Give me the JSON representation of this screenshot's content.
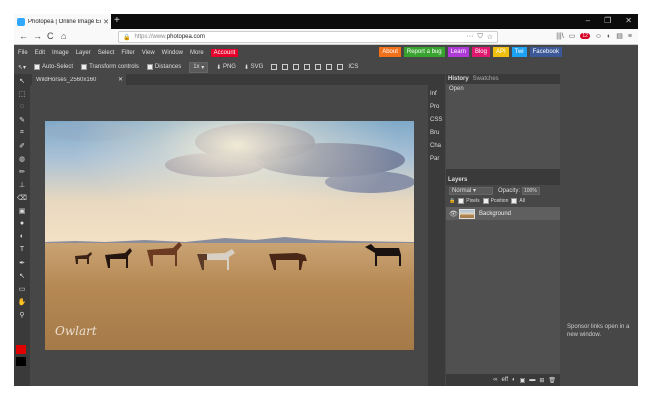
{
  "browser": {
    "tab_title": "Photopea | Online Image Editor",
    "tab_close": "✕",
    "new_tab": "+",
    "window_controls": [
      "–",
      "❐",
      "✕"
    ],
    "nav": {
      "back": "←",
      "forward": "→",
      "reload": "C",
      "home": "⌂"
    },
    "url_scheme": "https://www.",
    "url_host": "photopea.com",
    "url_actions": [
      "···",
      "⛉",
      "☆"
    ],
    "right_icons": [
      "|||\\",
      "▭",
      "☺",
      "◐",
      "▤",
      "≡"
    ],
    "notif_count": "12"
  },
  "menu": {
    "items": [
      "File",
      "Edit",
      "Image",
      "Layer",
      "Select",
      "Filter",
      "View",
      "Window",
      "More"
    ],
    "account": "Account",
    "promos": [
      {
        "label": "About",
        "color": "#f2701a"
      },
      {
        "label": "Report a bug",
        "color": "#38a32f"
      },
      {
        "label": "Learn",
        "color": "#b03ad8"
      },
      {
        "label": "Blog",
        "color": "#e0196f"
      },
      {
        "label": "API",
        "color": "#f0c010"
      },
      {
        "label": "Twi",
        "color": "#1da1f2"
      },
      {
        "label": "Facebook",
        "color": "#3b5998"
      }
    ]
  },
  "options": {
    "auto_select": "Auto-Select",
    "transform_controls": "Transform controls",
    "distances": "Distances",
    "scale_select": "1x",
    "png": "PNG",
    "svg": "SVG",
    "icons_label": "ICS"
  },
  "tools": [
    "↖",
    "⬚",
    "◌",
    "✎",
    "⌗",
    "✐",
    "◍",
    "✏",
    "⊥",
    "⌫",
    "▣",
    "●",
    "◐",
    "T",
    "✒",
    "↖",
    "▭",
    "✋",
    "⚲"
  ],
  "document": {
    "tab_name": "WildHorses_2560x160",
    "tab_close": "✕",
    "watermark": "Owlart"
  },
  "mini_panel": [
    "Inf",
    "Pro",
    "CSS",
    "Bru",
    "Cha",
    "Par"
  ],
  "history": {
    "tab_history": "History",
    "tab_swatches": "Swatches",
    "items": [
      "Open"
    ]
  },
  "layers": {
    "title": "Layers",
    "blend_mode": "Normal",
    "opacity_label": "Opacity:",
    "opacity_value": "100%",
    "lock_pixels": "Pixels",
    "lock_position": "Position",
    "lock_all": "All",
    "items": [
      {
        "name": "Background",
        "visible_icon": "👁"
      }
    ],
    "footer_icons": [
      "∞",
      "eff",
      "◐",
      "▣",
      "▬",
      "⊞",
      "🗑"
    ]
  },
  "sponsor": {
    "text": "Sponsor links open in a new window."
  }
}
